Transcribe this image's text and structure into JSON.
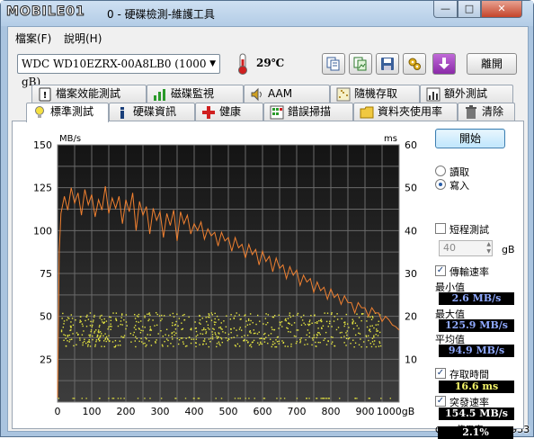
{
  "titlebar": {
    "logo": "MOBILE01",
    "title": "0 - 硬碟檢測-維護工具",
    "buttons": {
      "minimize": "—",
      "maximize": "□",
      "close": "✕"
    }
  },
  "menu": {
    "items": [
      "檔案(F)",
      "說明(H)"
    ]
  },
  "toolbar": {
    "drive": "WDC WD10EZRX-00A8LB0 (1000 gB)",
    "temperature": "29℃",
    "exit_label": "離開",
    "icons": [
      "copy-text-icon",
      "copy-image-icon",
      "save-icon",
      "options-icon",
      "download-icon"
    ]
  },
  "tabs_row1": [
    {
      "label": "檔案效能測試",
      "icon": "file-benchmark-icon"
    },
    {
      "label": "磁碟監視",
      "icon": "disk-monitor-icon"
    },
    {
      "label": "AAM",
      "icon": "speaker-icon"
    },
    {
      "label": "隨機存取",
      "icon": "random-access-icon"
    },
    {
      "label": "額外測試",
      "icon": "extra-tests-icon"
    }
  ],
  "tabs_row2": [
    {
      "label": "標準測試",
      "icon": "lightbulb-icon",
      "active": true
    },
    {
      "label": "硬碟資訊",
      "icon": "info-icon"
    },
    {
      "label": "健康",
      "icon": "health-cross-icon"
    },
    {
      "label": "錯誤掃描",
      "icon": "error-scan-icon"
    },
    {
      "label": "資料夾使用率",
      "icon": "folder-icon"
    },
    {
      "label": "清除",
      "icon": "erase-icon"
    }
  ],
  "side": {
    "start_label": "開始",
    "read_label": "讀取",
    "write_label": "寫入",
    "mode_selected": "寫入",
    "short_test_label": "短程測試",
    "short_test_checked": false,
    "short_test_value": "40",
    "short_test_unit": "gB",
    "transfer_label": "傳輸速率",
    "transfer_checked": true,
    "min_label": "最小值",
    "min_value": "2.6 MB/s",
    "max_label": "最大值",
    "max_value": "125.9 MB/s",
    "avg_label": "平均值",
    "avg_value": "94.9 MB/s",
    "access_label": "存取時間",
    "access_checked": true,
    "access_value": "16.6 ms",
    "burst_label": "突發速率",
    "burst_checked": true,
    "burst_value": "154.5 MB/s",
    "cpu_label": "CPU 使用率",
    "cpu_value": "2.1%"
  },
  "watermark": "#2207953",
  "colors": {
    "transfer_line": "#f08030",
    "access_points": "#e6e640",
    "plot_bg": "#202020"
  },
  "chart_data": {
    "type": "line",
    "left_axis_unit": "MB/s",
    "right_axis_unit": "ms",
    "y_ticks": [
      25,
      50,
      75,
      100,
      125,
      150
    ],
    "y2_ticks": [
      10,
      20,
      30,
      40,
      50,
      60
    ],
    "x_ticks": [
      0,
      100,
      200,
      300,
      400,
      500,
      600,
      700,
      800,
      900
    ],
    "x_tick_labels": [
      "0",
      "100",
      "200",
      "300",
      "400",
      "500",
      "600",
      "700",
      "800",
      "900",
      "1000gB"
    ],
    "xlim": [
      0,
      1000
    ],
    "ylim": [
      0,
      150
    ],
    "y2lim": [
      0,
      60
    ],
    "grid": true,
    "series": [
      {
        "axis": "left",
        "style": "line",
        "x": [
          0,
          5,
          10,
          20,
          30,
          40,
          50,
          60,
          70,
          80,
          90,
          100,
          110,
          120,
          130,
          140,
          150,
          160,
          170,
          180,
          190,
          200,
          210,
          220,
          230,
          240,
          250,
          260,
          270,
          280,
          290,
          300,
          310,
          320,
          330,
          340,
          350,
          360,
          370,
          380,
          390,
          400,
          410,
          420,
          430,
          440,
          450,
          460,
          470,
          480,
          490,
          500,
          510,
          520,
          530,
          540,
          550,
          560,
          570,
          580,
          590,
          600,
          610,
          620,
          630,
          640,
          650,
          660,
          670,
          680,
          690,
          700,
          710,
          720,
          730,
          740,
          750,
          760,
          770,
          780,
          790,
          800,
          810,
          820,
          830,
          840,
          850,
          860,
          870,
          880,
          890,
          900,
          910,
          920,
          930,
          940,
          950,
          960,
          970,
          980,
          990,
          1000
        ],
        "y": [
          2.6,
          88,
          110,
          120,
          112,
          125,
          116,
          122,
          109,
          124,
          115,
          121,
          108,
          118,
          112,
          125.9,
          110,
          119,
          113,
          120,
          104,
          118,
          111,
          122,
          100,
          117,
          109,
          114,
          98,
          113,
          106,
          111,
          96,
          110,
          103,
          112,
          94,
          111,
          104,
          109,
          98,
          104,
          100,
          105,
          95,
          101,
          97,
          99,
          91,
          99,
          94,
          96,
          88,
          96,
          90,
          92,
          84,
          92,
          86,
          89,
          80,
          88,
          82,
          85,
          76,
          84,
          78,
          80,
          72,
          79,
          74,
          77,
          68,
          74,
          70,
          72,
          64,
          70,
          65,
          67,
          60,
          66,
          61,
          63,
          57,
          62,
          58,
          58,
          52,
          58,
          55,
          55,
          50,
          55,
          52,
          52,
          47,
          50,
          48,
          45,
          44,
          42
        ]
      }
    ],
    "access_time_ms_cluster": {
      "center": 16.6,
      "spread": [
        13,
        21
      ],
      "outliers_low": 1
    }
  }
}
